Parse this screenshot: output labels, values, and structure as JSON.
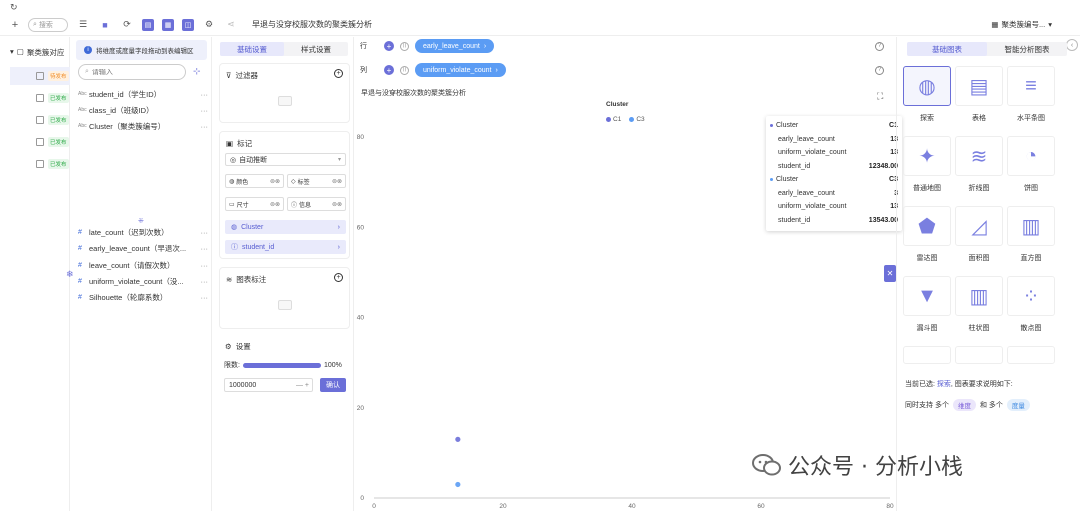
{
  "window": {
    "refresh_icon": "refresh-icon"
  },
  "toolbar": {
    "search_placeholder": "搜索",
    "title": "早退与没穿校服次数的聚类簇分析",
    "dataset_label": "聚类簇编号..."
  },
  "tree": {
    "root_label": "聚类簇对应",
    "items": [
      {
        "status": "待发布",
        "color": "#f08a24"
      },
      {
        "status": "已发布",
        "color": "#2aa845"
      },
      {
        "status": "已发布",
        "color": "#2aa845"
      },
      {
        "status": "已发布",
        "color": "#2aa845"
      },
      {
        "status": "已发布",
        "color": "#2aa845"
      }
    ]
  },
  "fields": {
    "hint": "将维度或度量字段拖动到表编辑区",
    "search_placeholder": "请输入",
    "dimensions": [
      {
        "type": "Abc",
        "name": "student_id（学生ID）"
      },
      {
        "type": "Abc",
        "name": "class_id（班级ID）"
      },
      {
        "type": "Abc",
        "name": "Cluster（聚类簇编号）"
      }
    ],
    "measures": [
      {
        "type": "#",
        "name": "late_count（迟到次数）"
      },
      {
        "type": "#",
        "name": "early_leave_count（早退次..."
      },
      {
        "type": "#",
        "name": "leave_count（请假次数）"
      },
      {
        "type": "#",
        "name": "uniform_violate_count（没..."
      },
      {
        "type": "#",
        "name": "Silhouette（轮廓系数）"
      }
    ]
  },
  "settings": {
    "tab_basic": "基础设置",
    "tab_style": "样式设置",
    "filter_title": "过滤器",
    "mark_title": "标记",
    "mark_select": "自动推断",
    "mark_buttons": [
      "颜色",
      "标签",
      "尺寸",
      "信息"
    ],
    "mark_fields": [
      "Cluster",
      "student_id"
    ],
    "annotation_title": "图表标注",
    "config_title": "设置",
    "limit_label": "限数:",
    "limit_value": "100%",
    "limit_fraction": 1.0,
    "limit_input": "1000000",
    "confirm": "确认"
  },
  "shelves": {
    "row_label": "行",
    "row_field": "early_leave_count",
    "col_label": "列",
    "col_field": "uniform_violate_count"
  },
  "chart_data": {
    "type": "scatter",
    "title": "早退与没穿校服次数的聚类簇分析",
    "legend_title": "Cluster",
    "legend_position": "top-center",
    "series": [
      {
        "name": "C1",
        "color": "#6b6fd8"
      },
      {
        "name": "C3",
        "color": "#5b9cf4"
      }
    ],
    "xlim": [
      0,
      80
    ],
    "ylim": [
      0,
      80
    ],
    "x_ticks": [
      0,
      20,
      40,
      60,
      80
    ],
    "y_ticks": [
      0,
      20,
      40,
      60,
      80
    ],
    "grid": false,
    "points": [
      {
        "series": "C1",
        "x": 13,
        "y": 13
      },
      {
        "series": "C3",
        "x": 13,
        "y": 3
      }
    ]
  },
  "tooltip": {
    "groups": [
      {
        "head_k": "Cluster",
        "head_v": "C1",
        "color": "#6b6fd8",
        "rows": [
          [
            "early_leave_count",
            "13"
          ],
          [
            "uniform_violate_count",
            "13"
          ],
          [
            "student_id",
            "12348.00"
          ]
        ]
      },
      {
        "head_k": "Cluster",
        "head_v": "C3",
        "color": "#5b9cf4",
        "rows": [
          [
            "early_leave_count",
            "3"
          ],
          [
            "uniform_violate_count",
            "13"
          ],
          [
            "student_id",
            "13543.00"
          ]
        ]
      }
    ]
  },
  "chart_types": {
    "tab_basic": "基础图表",
    "tab_smart": "智能分析图表",
    "items": [
      "探索",
      "表格",
      "水平条图",
      "普通地图",
      "折线图",
      "饼图",
      "雷达图",
      "面积图",
      "直方图",
      "漏斗图",
      "柱状图",
      "散点图"
    ],
    "current_label": "当前已选:",
    "current_value": "探索",
    "current_suffix": ", 图表要求说明如下:",
    "support_prefix": "同时支持 多个",
    "dim_tag": "维度",
    "and_text": "和 多个",
    "mea_tag": "度量"
  },
  "watermark": {
    "text": "公众号 · 分析小栈"
  }
}
